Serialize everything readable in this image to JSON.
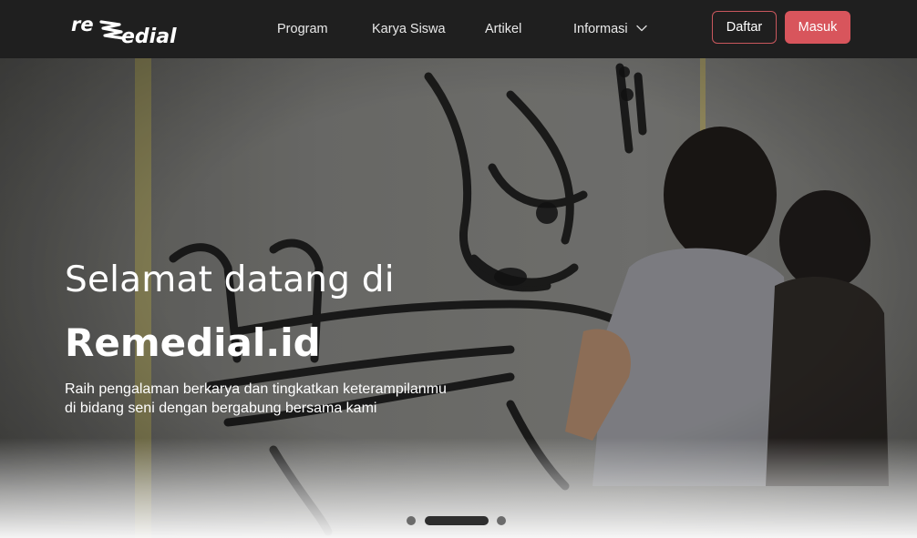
{
  "brand": {
    "logo_text": "reMedial"
  },
  "nav": {
    "program": "Program",
    "karya_siswa": "Karya Siswa",
    "artikel": "Artikel",
    "informasi": "Informasi"
  },
  "auth": {
    "daftar": "Daftar",
    "masuk": "Masuk"
  },
  "hero": {
    "greeting": "Selamat datang di",
    "brand_name": "Remedial.id",
    "description": "Raih pengalaman berkarya dan tingkatkan keterampilanmu di bidang seni dengan bergabung bersama kami"
  },
  "carousel": {
    "slide_count": 3,
    "active_index": 1
  },
  "colors": {
    "navbar_bg": "#1f1f1f",
    "accent": "#d8555c",
    "text_light": "#ffffff"
  },
  "icons": {
    "dropdown": "chevron-down-icon"
  }
}
